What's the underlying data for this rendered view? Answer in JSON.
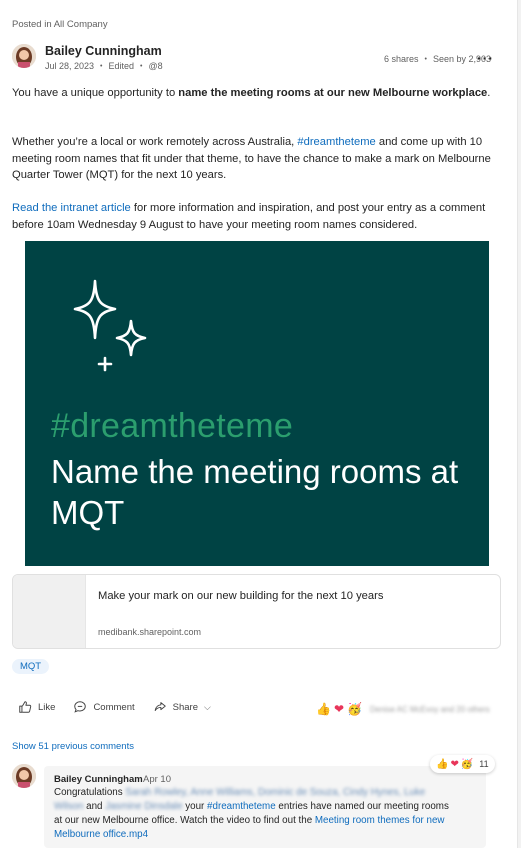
{
  "post": {
    "posted_in": "Posted in All Company",
    "author": "Bailey Cunningham",
    "date": "Jul 28, 2023",
    "edited": "Edited",
    "mentions": "@8",
    "shares": "6 shares",
    "seen_by": "Seen by 2,903",
    "more_icon": "more-horizontal-icon",
    "p1_pre": "You have a unique opportunity to ",
    "p1_bold": "name the meeting rooms at our new Melbourne workplace",
    "p1_post": ".",
    "p2_pre": "Whether you’re a local or work remotely across Australia, ",
    "p2_hashtag": "#dreamtheteme",
    "p2_post": " and come up with 10 meeting room names that fit under that theme, to have the chance to make a mark on Melbourne Quarter Tower (MQT) for the next 10 years.",
    "p3_link": "Read the intranet article",
    "p3_post": " for more information and inspiration, and post your entry as a comment before 10am Wednesday 9 August to have your meeting room names considered."
  },
  "hero": {
    "hashtag": "#dreamtheteme",
    "headline": "Name the meeting rooms at MQT",
    "bg_color": "#004344",
    "accent_color": "#2b9e6e"
  },
  "link_preview": {
    "title": "Make your mark on our new building for the next 10 years",
    "domain": "medibank.sharepoint.com"
  },
  "topic": "MQT",
  "actions": {
    "like": "Like",
    "comment": "Comment",
    "share": "Share"
  },
  "reactions": {
    "icons": [
      "thumbs-up-icon",
      "heart-icon",
      "celebrate-icon"
    ],
    "reactors_text": "Denise AC McEvoy and 20 others"
  },
  "comments": {
    "show_previous": "Show 51 previous comments",
    "author": "Bailey Cunningham",
    "date": "Apr 10",
    "text_pre": "Congratulations ",
    "names_a": "Sarah Rowley, Anne Williams, Dominic de Souza, Cindy Hynes, Luke Wilson",
    "text_and": " and ",
    "names_b": "Jasmine Dinsdale",
    "text_your": " your ",
    "hashtag": "#dreamtheteme",
    "text_mid": " entries have named our meeting rooms at our new Melbourne office. Watch the video to find out the ",
    "video_link": "Meeting room themes for new Melbourne office.mp4",
    "reaction_count": "11"
  }
}
